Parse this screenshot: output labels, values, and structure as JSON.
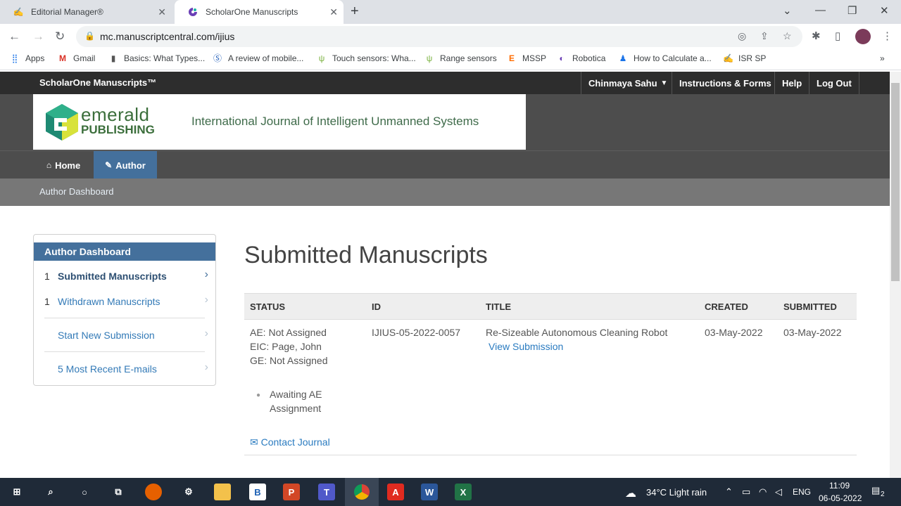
{
  "browser": {
    "tabs": [
      {
        "label": "Editorial Manager®",
        "icon": "em-icon"
      },
      {
        "label": "ScholarOne Manuscripts",
        "icon": "scholarone-icon"
      }
    ],
    "url": "mc.manuscriptcentral.com/ijius",
    "bookmarks": [
      "Apps",
      "Gmail",
      "Basics: What Types...",
      "A review of mobile...",
      "Touch sensors: Wha...",
      "Range sensors",
      "MSSP",
      "Robotica",
      "How to Calculate a...",
      "ISR SP"
    ]
  },
  "site": {
    "brand": "ScholarOne Manuscripts™",
    "user": "Chinmaya Sahu",
    "instructions": "Instructions & Forms",
    "help": "Help",
    "logout": "Log Out",
    "logo_line1": "emerald",
    "logo_line2": "PUBLISHING",
    "journal": "International Journal of Intelligent Unmanned Systems",
    "menu": {
      "home": "Home",
      "author": "Author"
    },
    "breadcrumb": "Author Dashboard"
  },
  "sidebar": {
    "heading": "Author Dashboard",
    "items": [
      {
        "num": "1",
        "label": "Submitted Manuscripts"
      },
      {
        "num": "1",
        "label": "Withdrawn Manuscripts"
      },
      {
        "num": "",
        "label": "Start New Submission"
      },
      {
        "num": "",
        "label": "5 Most Recent E-mails"
      }
    ]
  },
  "main": {
    "title": "Submitted Manuscripts",
    "columns": [
      "STATUS",
      "ID",
      "TITLE",
      "CREATED",
      "SUBMITTED"
    ],
    "row": {
      "status_ae": "AE: Not Assigned",
      "status_eic": "EIC: Page, John",
      "status_ge": "GE: Not Assigned",
      "stage_line1": "Awaiting AE",
      "stage_line2": "Assignment",
      "contact": "Contact Journal",
      "id": "IJIUS-05-2022-0057",
      "title": "Re-Sizeable Autonomous Cleaning Robot",
      "view": "View Submission",
      "created": "03-May-2022",
      "submitted": "03-May-2022"
    }
  },
  "taskbar": {
    "weather": "34°C  Light rain",
    "lang": "ENG",
    "time": "11:09",
    "date": "06-05-2022",
    "notif_count": "2"
  },
  "colors": {
    "header_dark": "#2d2d2d",
    "nav_gray": "#4d4d4d",
    "author_tab": "#44709c",
    "link": "#337ab7"
  }
}
